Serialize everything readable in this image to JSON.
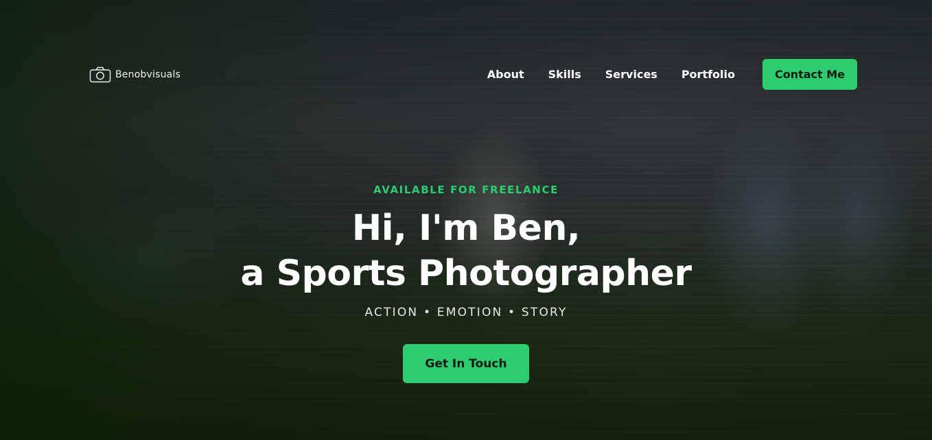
{
  "brand": {
    "name": "Benobvisuals",
    "icon": "camera-icon"
  },
  "nav": {
    "links": [
      "About",
      "Skills",
      "Services",
      "Portfolio"
    ],
    "cta": "Contact Me"
  },
  "hero": {
    "eyebrow": "AVAILABLE FOR FREELANCE",
    "headline_line1": "Hi, I'm Ben,",
    "headline_line2": "a Sports Photographer",
    "tagline": "ACTION • EMOTION • STORY",
    "cta": "Get In Touch"
  },
  "colors": {
    "accent": "#2ecc71",
    "text": "#ffffff"
  }
}
